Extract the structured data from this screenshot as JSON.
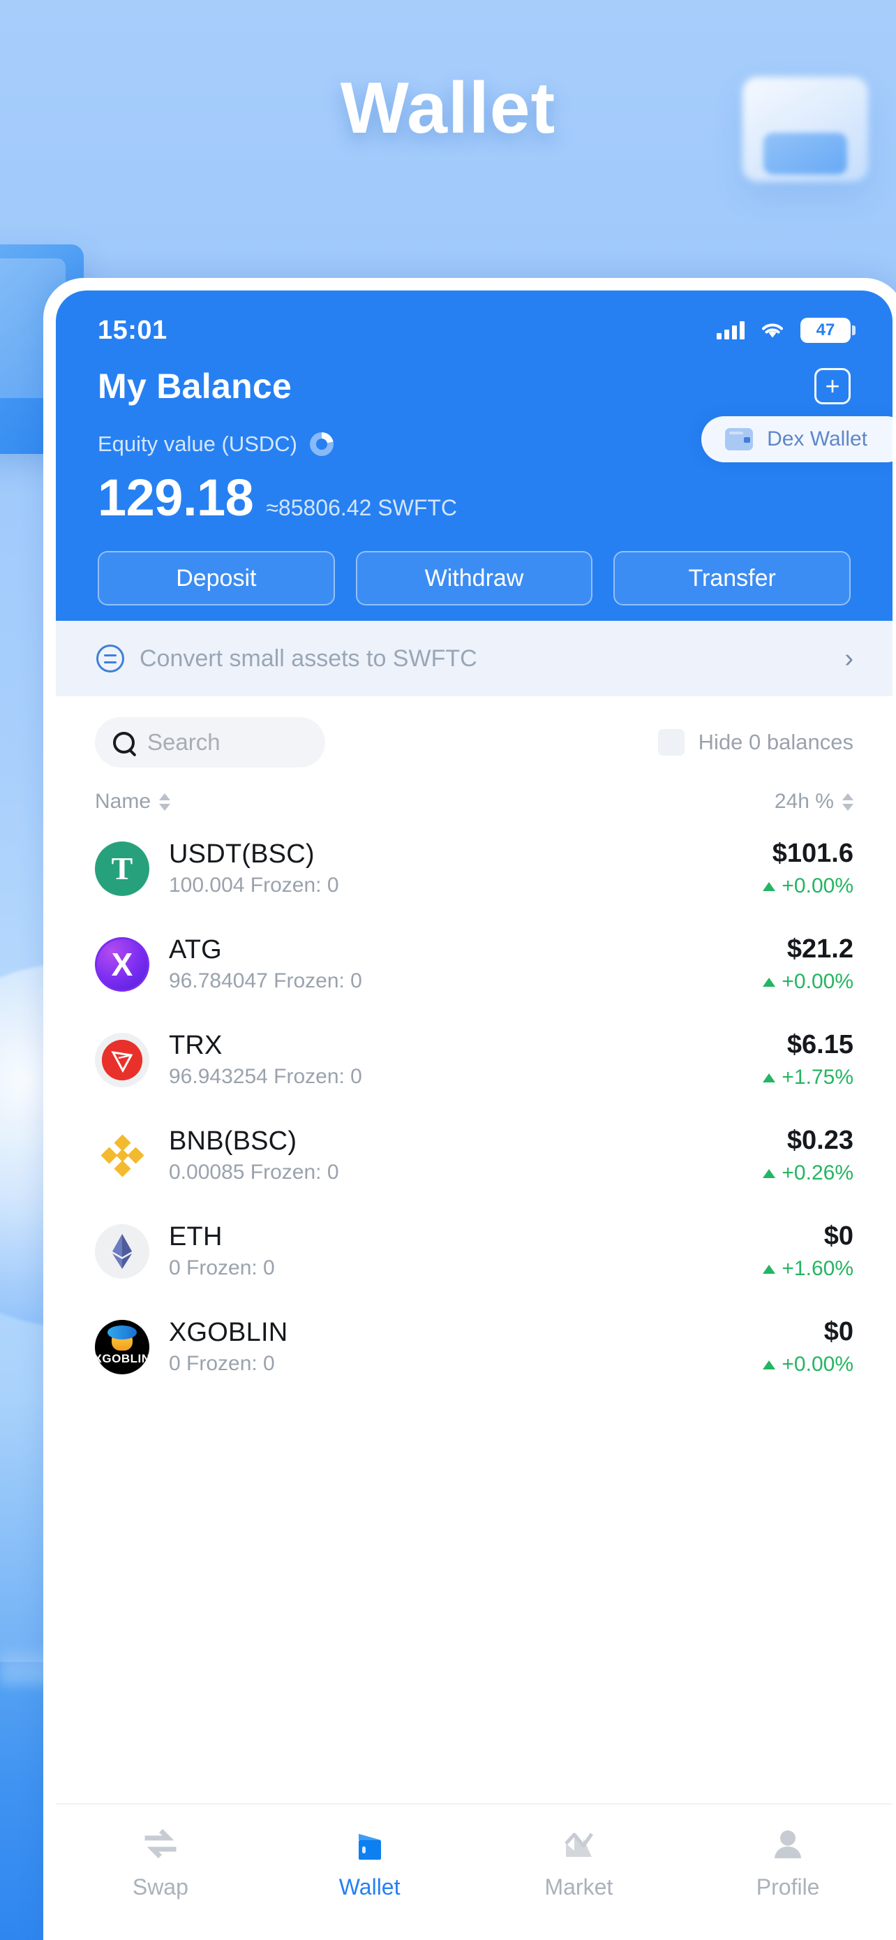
{
  "hero": {
    "title": "Wallet"
  },
  "statusbar": {
    "time": "15:01",
    "signal_icon": "signal-bars-icon",
    "wifi_icon": "wifi-icon",
    "battery_level": "47"
  },
  "header": {
    "title": "My Balance",
    "add_label": "+",
    "equity_label": "Equity value (USDC)",
    "equity_icon": "donut-chart-icon",
    "wallet_switch": {
      "label": "Dex Wallet",
      "icon": "wallet-icon"
    },
    "amount": "129.18",
    "amount_alt": "≈85806.42 SWFTC",
    "actions": [
      "Deposit",
      "Withdraw",
      "Transfer"
    ],
    "accent": "#2680f2"
  },
  "convert": {
    "icon": "convert-equals-icon",
    "text": "Convert small assets to SWFTC",
    "chevron": "›"
  },
  "toolbar": {
    "search_placeholder": "Search",
    "search_icon": "search-icon",
    "hide_label": "Hide 0 balances",
    "hide_checked": false
  },
  "table": {
    "col_name": "Name",
    "col_change": "24h %",
    "rows": [
      {
        "icon": "usdt-icon",
        "name": "USDT(BSC)",
        "sub": "100.004 Frozen: 0",
        "value": "$101.6",
        "change": "+0.00%",
        "direction": "up"
      },
      {
        "icon": "atg-icon",
        "name": "ATG",
        "sub": "96.784047 Frozen: 0",
        "value": "$21.2",
        "change": "+0.00%",
        "direction": "up"
      },
      {
        "icon": "trx-icon",
        "name": "TRX",
        "sub": "96.943254 Frozen: 0",
        "value": "$6.15",
        "change": "+1.75%",
        "direction": "up"
      },
      {
        "icon": "bnb-icon",
        "name": "BNB(BSC)",
        "sub": "0.00085 Frozen: 0",
        "value": "$0.23",
        "change": "+0.26%",
        "direction": "up"
      },
      {
        "icon": "eth-icon",
        "name": "ETH",
        "sub": "0 Frozen: 0",
        "value": "$0",
        "change": "+1.60%",
        "direction": "up"
      },
      {
        "icon": "xgoblin-icon",
        "name": "XGOBLIN",
        "sub": "0 Frozen: 0",
        "value": "$0",
        "change": "+0.00%",
        "direction": "up"
      }
    ]
  },
  "tabbar": {
    "items": [
      {
        "label": "Swap",
        "icon": "swap-icon",
        "active": false
      },
      {
        "label": "Wallet",
        "icon": "wallet-icon",
        "active": true
      },
      {
        "label": "Market",
        "icon": "market-chart-icon",
        "active": false
      },
      {
        "label": "Profile",
        "icon": "profile-person-icon",
        "active": false
      }
    ],
    "active_color": "#2680f2",
    "inactive_color": "#c7ccd3"
  },
  "colors": {
    "positive": "#24b562",
    "brand": "#2680f2",
    "muted": "#9aa2ad"
  }
}
